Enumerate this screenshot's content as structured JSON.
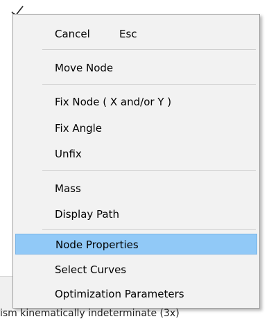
{
  "context_menu": {
    "items": [
      {
        "label": "Cancel",
        "shortcut": "Esc"
      },
      {
        "label": "Move Node"
      },
      {
        "label": "Fix Node ( X and/or Y )"
      },
      {
        "label": "Fix Angle"
      },
      {
        "label": "Unfix"
      },
      {
        "label": "Mass"
      },
      {
        "label": "Display Path"
      },
      {
        "label": "Node Properties",
        "highlighted": true
      },
      {
        "label": "Select Curves"
      },
      {
        "label": "Optimization Parameters"
      }
    ]
  },
  "background": {
    "status_text": "ism kinematically indeterminate (3x)"
  },
  "colors": {
    "menu_background": "#f2f2f2",
    "highlight": "#91c9f7",
    "separator": "#cfcfcf"
  }
}
